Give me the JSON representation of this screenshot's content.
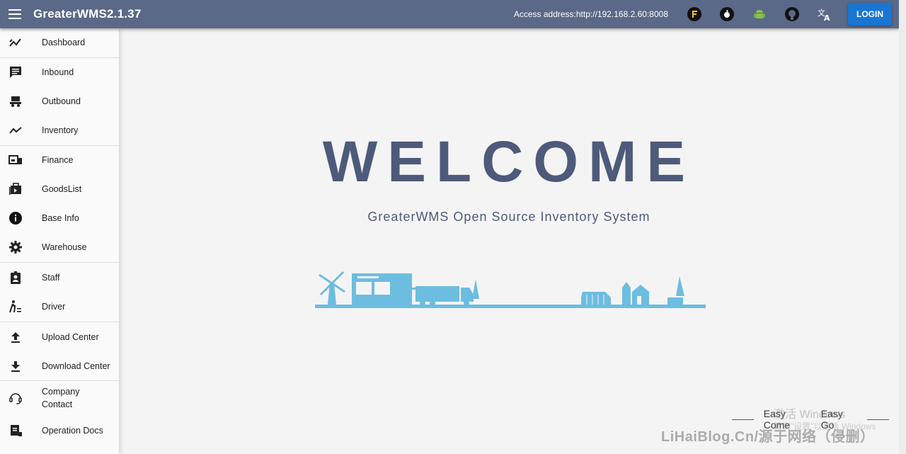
{
  "header": {
    "title": "GreaterWMS2.1.37",
    "access_address": "Access address:http://192.168.2.60:8008",
    "login_label": "LOGIN",
    "icons": [
      "menu-icon",
      "fuzzing-icon",
      "apple-icon",
      "android-icon",
      "github-icon",
      "translate-icon"
    ]
  },
  "sidebar": {
    "items": [
      {
        "label": "Dashboard",
        "icon": "dashboard-icon"
      },
      {
        "label": "Inbound",
        "icon": "inbound-icon"
      },
      {
        "label": "Outbound",
        "icon": "outbound-icon"
      },
      {
        "label": "Inventory",
        "icon": "inventory-icon"
      },
      {
        "label": "Finance",
        "icon": "finance-icon"
      },
      {
        "label": "GoodsList",
        "icon": "goodslist-icon"
      },
      {
        "label": "Base Info",
        "icon": "info-icon"
      },
      {
        "label": "Warehouse",
        "icon": "gear-icon"
      },
      {
        "label": "Staff",
        "icon": "staff-icon"
      },
      {
        "label": "Driver",
        "icon": "driver-icon"
      },
      {
        "label": "Upload Center",
        "icon": "upload-icon"
      },
      {
        "label": "Download Center",
        "icon": "download-icon"
      },
      {
        "label": "Company Contact",
        "icon": "headset-icon"
      },
      {
        "label": "Operation Docs",
        "icon": "docs-icon"
      }
    ]
  },
  "main": {
    "welcome": "WELCOME",
    "subtitle": "GreaterWMS Open Source Inventory System",
    "easy_come": "Easy Come",
    "easy_go": "Easy Go"
  },
  "overlay": {
    "activate_windows": "激活 Windows",
    "activate_hint": "转到\"设置\"以激活 Windows",
    "site_watermark": "LiHaiBlog.Cn/源于网络（侵删）"
  },
  "colors": {
    "header_bg": "#5a6987",
    "login_bg": "#1976d2",
    "welcome_text": "#4d5a7a",
    "illustration": "#6dbde0"
  }
}
